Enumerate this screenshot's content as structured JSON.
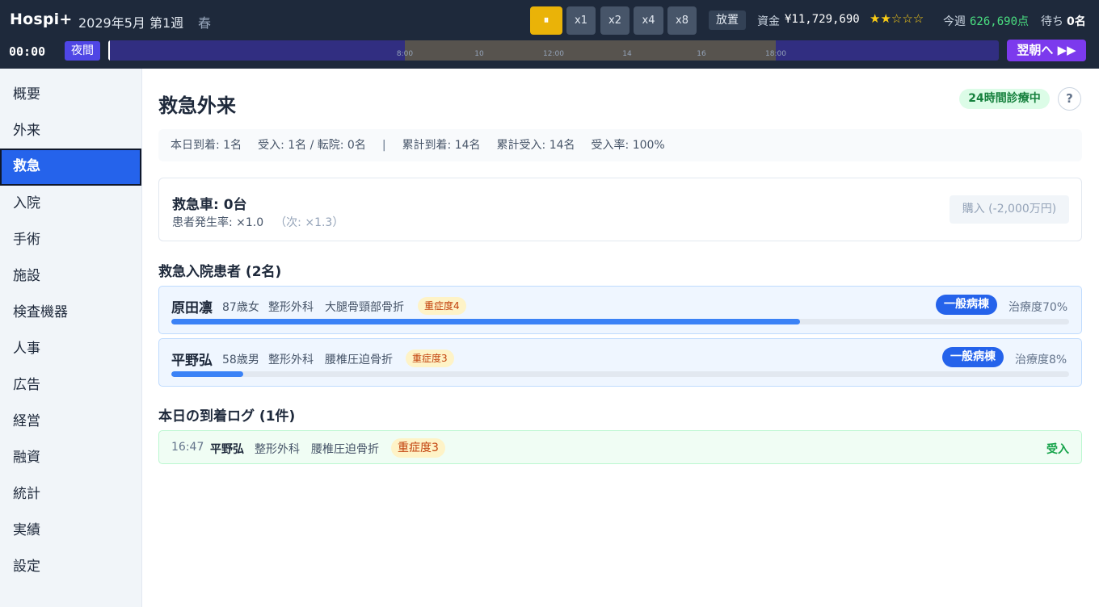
{
  "header": {
    "app_title": "Hospi+",
    "date": "2029年5月 第1週",
    "season": "春",
    "pause_label": "⏸",
    "speeds": [
      "x1",
      "x2",
      "x4",
      "x8"
    ],
    "neglect_label": "放置",
    "fund_label": "資金",
    "fund_value": "¥11,729,690",
    "stars": "★★☆☆☆",
    "rating": 2,
    "week_label": "今週",
    "week_value": "626,690点",
    "wait_label": "待ち",
    "wait_value": "0名",
    "clock": "00:00",
    "period_label": "夜間",
    "timeline_ticks": [
      "8:00",
      "10",
      "12:00",
      "14",
      "16",
      "18:00"
    ],
    "next_button": "翌朝へ ▶▶"
  },
  "sidebar": {
    "items": [
      "概要",
      "外来",
      "救急",
      "入院",
      "手術",
      "施設",
      "検査機器",
      "人事",
      "広告",
      "経営",
      "融資",
      "統計",
      "実績",
      "設定"
    ],
    "active_index": 2
  },
  "main": {
    "title": "救急外来",
    "open_badge": "24時間診療中",
    "help": "?",
    "stats": {
      "today_arrived": "本日到着: 1名",
      "accepted": "受入: 1名 / 転院: 0名",
      "separator": "|",
      "total_arrived": "累計到着: 14名",
      "total_accepted": "累計受入: 14名",
      "accept_rate": "受入率: 100%"
    },
    "ambulance": {
      "title": "救急車: 0台",
      "rate": "患者発生率: ×1.0",
      "next_rate": "（次: ×1.3）",
      "buy_button": "購入 (-2,000万円)"
    },
    "patients_title": "救急入院患者 (2名)",
    "patients": [
      {
        "name": "原田凛",
        "age_sex": "87歳女",
        "dept": "整形外科",
        "diagnosis": "大腿骨頸部骨折",
        "severity": "重症度4",
        "ward": "一般病棟",
        "progress_label": "治療度70%",
        "progress": 0.7
      },
      {
        "name": "平野弘",
        "age_sex": "58歳男",
        "dept": "整形外科",
        "diagnosis": "腰椎圧迫骨折",
        "severity": "重症度3",
        "ward": "一般病棟",
        "progress_label": "治療度8%",
        "progress": 0.08
      }
    ],
    "log_title": "本日の到着ログ (1件)",
    "log": [
      {
        "time": "16:47",
        "name": "平野弘",
        "dept": "整形外科",
        "diagnosis": "腰椎圧迫骨折",
        "severity": "重症度3",
        "result": "受入"
      }
    ]
  },
  "colors": {
    "header_bg": "#1e293b",
    "accent": "#2563eb",
    "pause_active": "#eab308",
    "next_button": "#7c3aed",
    "success": "#16a34a"
  }
}
